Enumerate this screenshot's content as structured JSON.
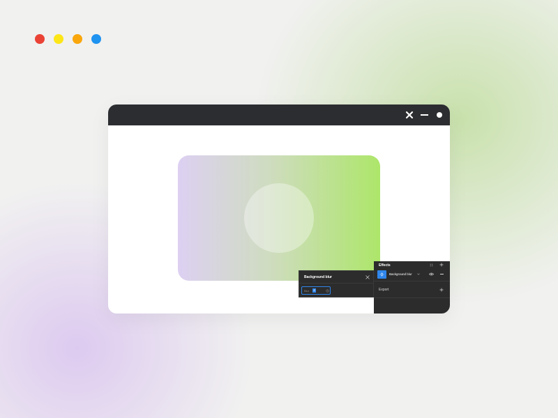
{
  "colors": {
    "dot_red": "#ea4335",
    "dot_yellow": "#fde617",
    "dot_orange": "#f9a70c",
    "dot_blue": "#1f93f0",
    "titlebar": "#2c2d30",
    "panel": "#2c2c2c",
    "accent": "#2f86eb"
  },
  "window": {
    "controls": {
      "close_icon": "close-icon",
      "minimize_icon": "minimize-icon",
      "maximize_icon": "circle-icon"
    }
  },
  "blur_popover": {
    "title": "Background blur",
    "close_icon": "close-icon",
    "field_label": "Blur",
    "field_value": "4",
    "reset_icon": "reset-icon"
  },
  "effects_panel": {
    "title": "Effects",
    "styles_icon": "grid-dots-icon",
    "add_icon": "plus-icon",
    "row": {
      "icon": "sun-icon",
      "label": "Background blur",
      "chevron_icon": "chevron-down-icon",
      "visibility_icon": "eye-icon",
      "remove_icon": "minus-icon"
    },
    "export": {
      "title": "Export",
      "add_icon": "plus-icon"
    }
  }
}
